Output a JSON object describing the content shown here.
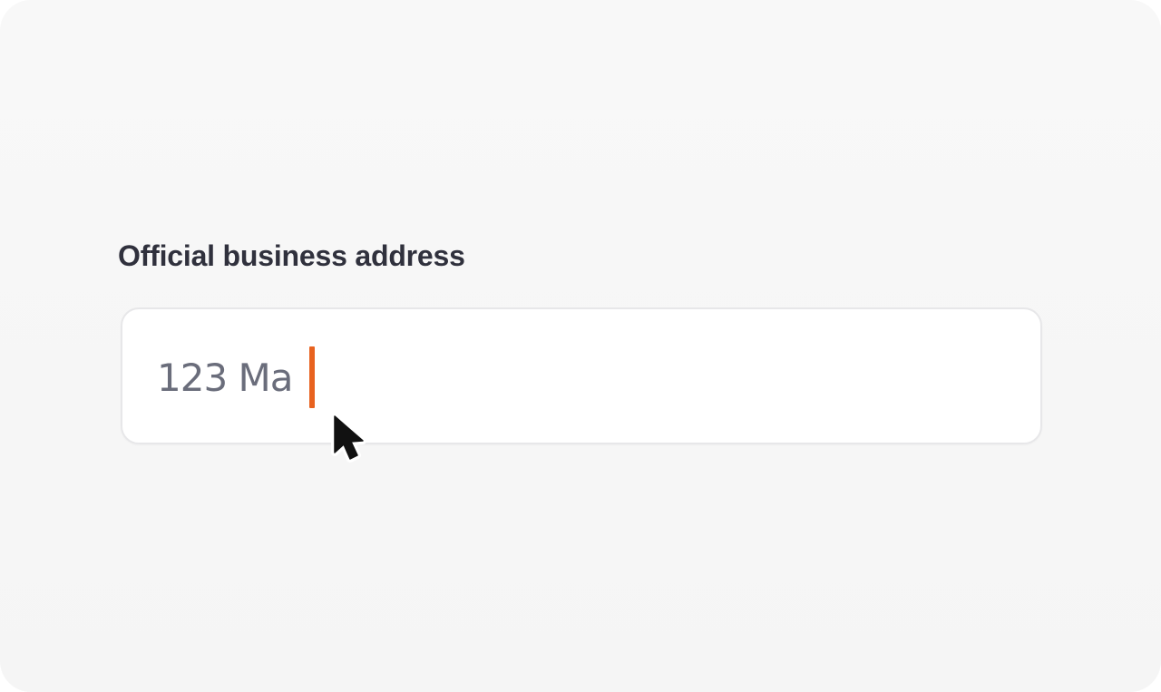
{
  "form": {
    "label": "Official business address",
    "value": "123 Ma"
  },
  "colors": {
    "caret": "#e8621f",
    "label_text": "#30313d",
    "value_text": "#6a6d7b",
    "field_border": "#e7e7e9"
  },
  "icons": {
    "pointer": "mouse-pointer-icon"
  }
}
